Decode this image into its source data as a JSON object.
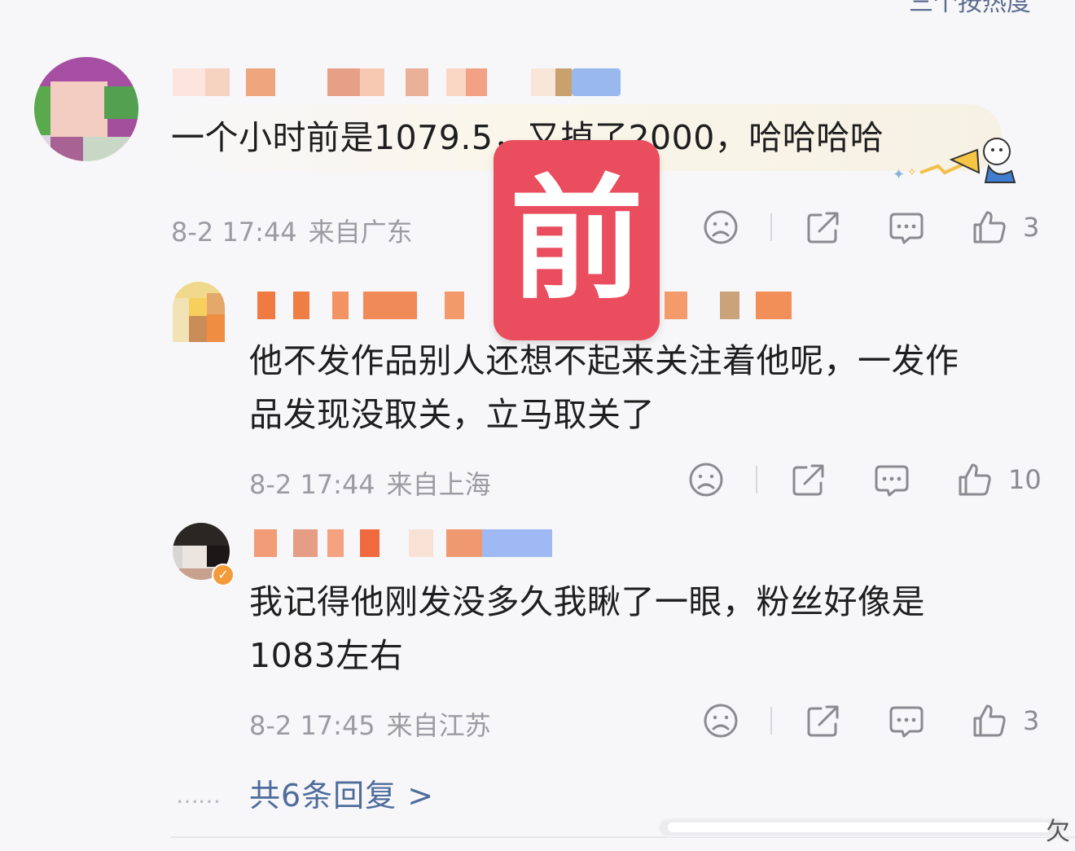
{
  "header_fragment": "三个按热度",
  "comments": [
    {
      "text": "一个小时前是1079.5，又掉了2000，哈哈哈哈",
      "time": "8-2 17:44",
      "location": "来自广东",
      "likes": "3"
    },
    {
      "text_line1": "他不发作品别人还想不起来关注着他呢，一发作",
      "text_line2": "品发现没取关，立马取关了",
      "time": "8-2 17:44",
      "location": "来自上海",
      "likes": "10"
    },
    {
      "text_line1": "我记得他刚发没多久我瞅了一眼，粉丝好像是",
      "text_line2": "1083左右",
      "time": "8-2 17:45",
      "location": "来自江苏",
      "likes": "3"
    }
  ],
  "stamp_label": "前",
  "more_replies": "共6条回复 >",
  "dots": "……",
  "corner_char": "欠",
  "colors": {
    "background": "#f7f7f9",
    "stamp": "#e94d5e",
    "link": "#4f6c9c",
    "meta": "#9b9ba2"
  },
  "icons": [
    "dislike-icon",
    "share-icon",
    "comment-icon",
    "like-icon",
    "megaphone-sticker-icon",
    "verified-badge-icon"
  ]
}
